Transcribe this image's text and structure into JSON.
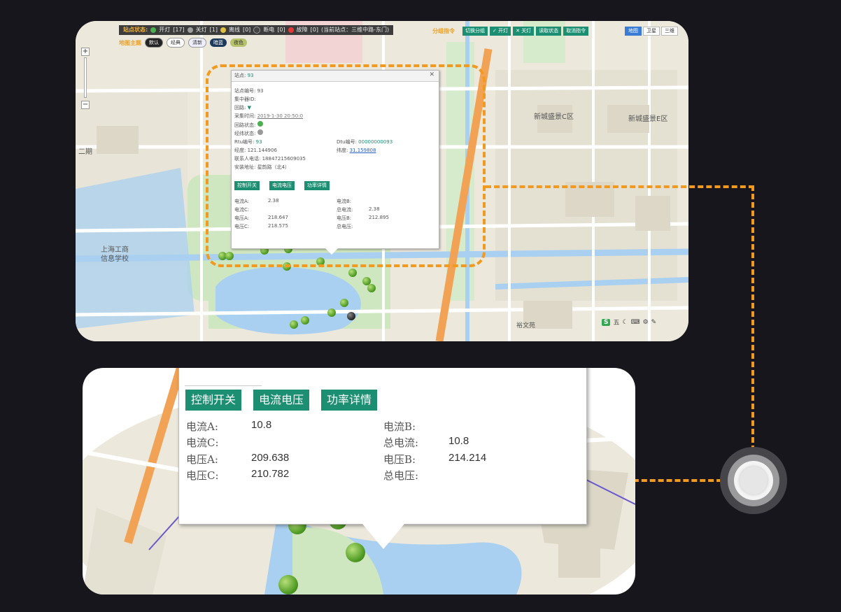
{
  "colors": {
    "accent_green": "#1c8f73",
    "highlight_orange": "#f29a1f",
    "background": "#16161c",
    "marker_on": "#4e9a23",
    "road_orange": "#f2a254",
    "water": "#a9d0f0"
  },
  "toolbar": {
    "status_label": "站点状态:",
    "legend": [
      {
        "label": "开灯",
        "count": "[17]",
        "color": "#4caf50"
      },
      {
        "label": "关灯",
        "count": "[1]",
        "color": "#9e9e9e"
      },
      {
        "label": "离线",
        "count": "[0]",
        "color": "#e0c040"
      },
      {
        "label": "断电",
        "count": "[0]",
        "color": "#444444"
      },
      {
        "label": "故障",
        "count": "[0]",
        "color": "#e53935"
      }
    ],
    "current_site": "(当前站点：三维中路-东门)",
    "theme_label": "地图主题",
    "themes": [
      "默认",
      "经典",
      "清新",
      "暗蓝",
      "夜色"
    ],
    "group_label": "分组指令",
    "group_buttons": [
      "切换分组",
      "开灯",
      "关灯",
      "读取状态",
      "取消指令"
    ],
    "map_types": [
      "地图",
      "卫星",
      "三维"
    ]
  },
  "map_labels": {
    "district_c": "新城盛景C区",
    "district_e": "新城盛景E区",
    "school_line1": "上海工商",
    "school_line2": "信息学校",
    "road_left": "二期",
    "wenyuan": "裕文苑"
  },
  "toolbox": {
    "s_icon": "S",
    "mode": "五"
  },
  "popup_small": {
    "title_label": "站点:",
    "title_value": "93",
    "rows": [
      {
        "label": "站点编号:",
        "value": "93"
      },
      {
        "label": "集中器ID:",
        "value": ""
      },
      {
        "label": "回路:",
        "value": "▼"
      },
      {
        "label": "采集时间:",
        "value": "2019-1-30 20:50:0"
      },
      {
        "label": "回路状态:",
        "value": ""
      },
      {
        "label": "经纬状态:",
        "value": ""
      }
    ],
    "rtu_label": "Rtu编号:",
    "rtu_value": "93",
    "dtu_label": "Dtu编号:",
    "dtu_value": "00000000093",
    "lng_label": "经度:",
    "lng_value": "121.144906",
    "lat_label": "纬度:",
    "lat_value": "31.159808",
    "contact_label": "联系人电话:",
    "contact_value": "18847215609035",
    "address_label": "安装地址:",
    "address_value": "星韵路（北4）",
    "tabs": [
      "控制开关",
      "电流电压",
      "功率详情"
    ],
    "electric": [
      {
        "label": "电流A:",
        "value": "2.38"
      },
      {
        "label": "电流B:",
        "value": ""
      },
      {
        "label": "电流C:",
        "value": ""
      },
      {
        "label": "总电流:",
        "value": "2.38"
      },
      {
        "label": "电压A:",
        "value": "218.647"
      },
      {
        "label": "电压B:",
        "value": "212.895"
      },
      {
        "label": "电压C:",
        "value": "218.575"
      },
      {
        "label": "总电压:",
        "value": ""
      }
    ]
  },
  "popup_zoom": {
    "tabs": [
      "控制开关",
      "电流电压",
      "功率详情"
    ],
    "electric": [
      {
        "label": "电流A:",
        "value": "10.8"
      },
      {
        "label": "电流B:",
        "value": ""
      },
      {
        "label": "电流C:",
        "value": ""
      },
      {
        "label": "总电流:",
        "value": "10.8"
      },
      {
        "label": "电压A:",
        "value": "209.638"
      },
      {
        "label": "电压B:",
        "value": "214.214"
      },
      {
        "label": "电压C:",
        "value": "210.782"
      },
      {
        "label": "总电压:",
        "value": ""
      }
    ]
  }
}
